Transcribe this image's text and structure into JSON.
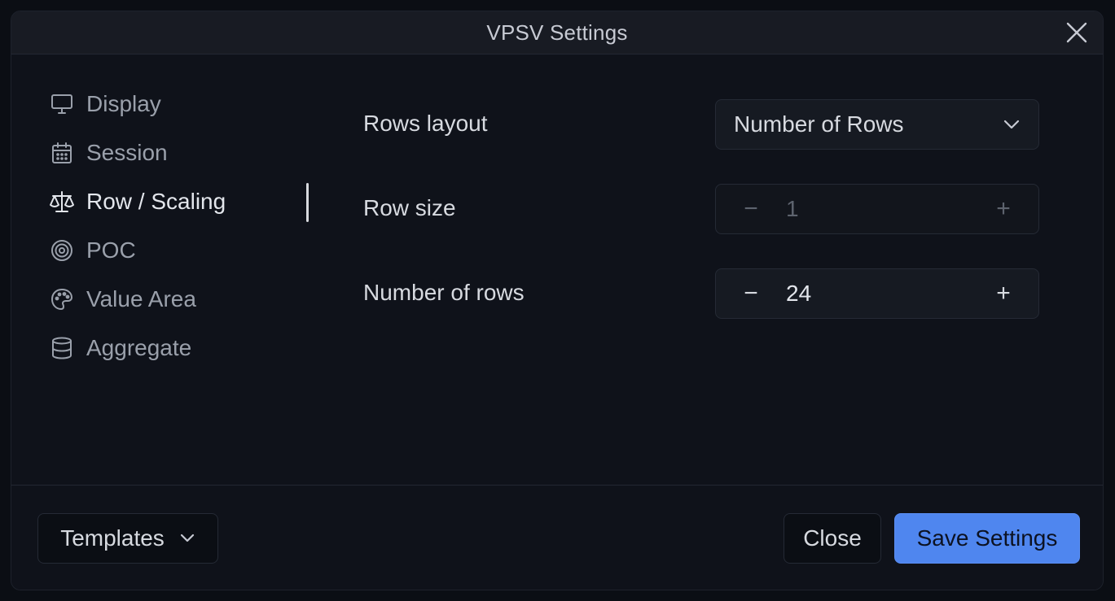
{
  "dialog": {
    "title": "VPSV Settings"
  },
  "sidebar": {
    "items": [
      {
        "label": "Display",
        "icon": "monitor-icon",
        "active": false
      },
      {
        "label": "Session",
        "icon": "calendar-icon",
        "active": false
      },
      {
        "label": "Row / Scaling",
        "icon": "scale-icon",
        "active": true
      },
      {
        "label": "POC",
        "icon": "target-icon",
        "active": false
      },
      {
        "label": "Value Area",
        "icon": "palette-icon",
        "active": false
      },
      {
        "label": "Aggregate",
        "icon": "database-icon",
        "active": false
      }
    ]
  },
  "settings": {
    "rows_layout": {
      "label": "Rows layout",
      "value": "Number of Rows"
    },
    "row_size": {
      "label": "Row size",
      "value": "1",
      "disabled": true
    },
    "number_of_rows": {
      "label": "Number of rows",
      "value": "24",
      "disabled": false
    },
    "minus": "−",
    "plus": "+"
  },
  "footer": {
    "templates_label": "Templates",
    "close_label": "Close",
    "save_label": "Save Settings"
  },
  "colors": {
    "accent": "#4f86ef",
    "background": "#0f121a"
  }
}
